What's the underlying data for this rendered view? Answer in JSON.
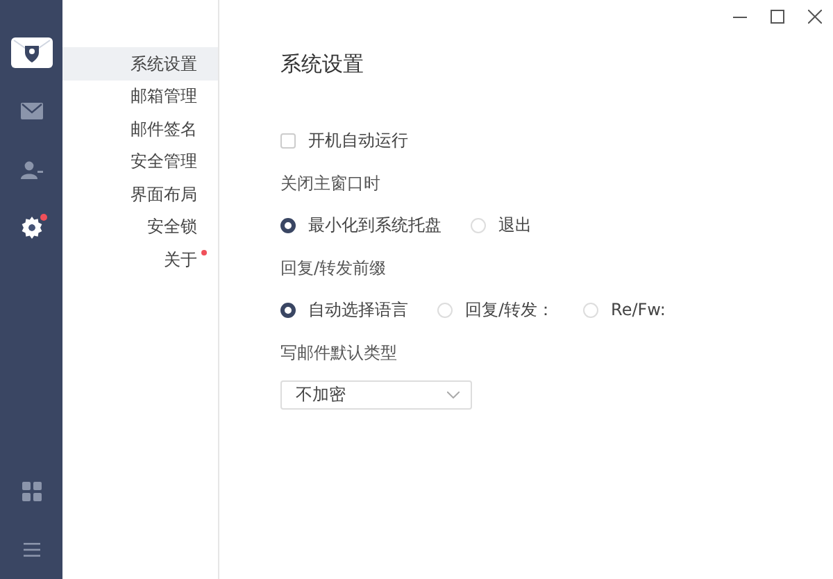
{
  "rail": {
    "items": [
      {
        "kind": "logo",
        "selected": false,
        "badge": false
      },
      {
        "kind": "mail",
        "selected": false,
        "badge": false
      },
      {
        "kind": "contacts",
        "selected": false,
        "badge": false
      },
      {
        "kind": "settings",
        "selected": true,
        "badge": true
      }
    ],
    "bottom_items": [
      {
        "kind": "apps",
        "selected": false,
        "badge": false
      },
      {
        "kind": "menu",
        "selected": false,
        "badge": false
      }
    ]
  },
  "nav": {
    "items": [
      {
        "label": "系统设置",
        "selected": true,
        "badge": false
      },
      {
        "label": "邮箱管理",
        "selected": false,
        "badge": false
      },
      {
        "label": "邮件签名",
        "selected": false,
        "badge": false
      },
      {
        "label": "安全管理",
        "selected": false,
        "badge": false
      },
      {
        "label": "界面布局",
        "selected": false,
        "badge": false
      },
      {
        "label": "安全锁",
        "selected": false,
        "badge": false
      },
      {
        "label": "关于",
        "selected": false,
        "badge": true
      }
    ]
  },
  "settings": {
    "title": "系统设置",
    "rows": [
      {
        "kind": "checkbox",
        "label": "开机自动运行",
        "checked": false
      },
      {
        "kind": "label",
        "label": "关闭主窗口时"
      },
      {
        "kind": "radios",
        "options": [
          {
            "label": "最小化到系统托盘",
            "selected": true
          },
          {
            "label": "退出",
            "selected": false
          }
        ]
      },
      {
        "kind": "label",
        "label": "回复/转发前缀"
      },
      {
        "kind": "radios",
        "options": [
          {
            "label": "自动选择语言",
            "selected": true
          },
          {
            "label": "回复/转发：",
            "selected": false
          },
          {
            "label": "Re/Fw:",
            "selected": false
          }
        ]
      },
      {
        "kind": "label",
        "label": "写邮件默认类型"
      },
      {
        "kind": "select",
        "value": "不加密"
      }
    ]
  }
}
